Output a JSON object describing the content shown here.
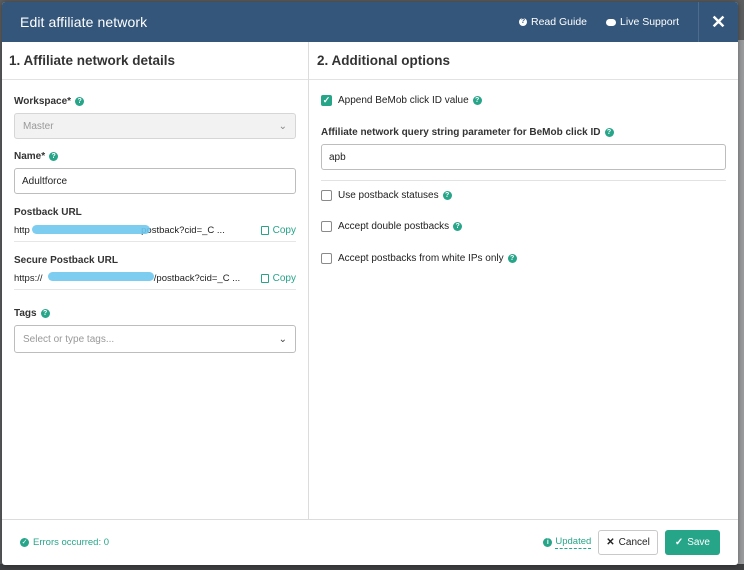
{
  "modal": {
    "title": "Edit affiliate network",
    "read_guide": "Read Guide",
    "live_support": "Live Support",
    "close": "✕"
  },
  "left": {
    "section_title": "1. Affiliate network details",
    "workspace_label": "Workspace*",
    "workspace_value": "Master",
    "name_label": "Name*",
    "name_value": "Adultforce",
    "postback_label": "Postback URL",
    "postback_prefix": "http",
    "postback_suffix": "postback?cid=_C ...",
    "secure_label": "Secure Postback URL",
    "secure_prefix": "https://",
    "secure_suffix": "/postback?cid=_C ...",
    "copy_label": "Copy",
    "tags_label": "Tags",
    "tags_placeholder": "Select or type tags..."
  },
  "right": {
    "section_title": "2. Additional options",
    "append_label": "Append BeMob click ID value",
    "append_checked": true,
    "param_label": "Affiliate network query string parameter for BeMob click ID",
    "param_value": "apb",
    "use_postback_label": "Use postback statuses",
    "accept_double_label": "Accept double postbacks",
    "white_ips_label": "Accept postbacks from white IPs only"
  },
  "footer": {
    "errors": "Errors occurred: 0",
    "updated": "Updated",
    "cancel": "Cancel",
    "save": "Save"
  },
  "colors": {
    "header": "#34567b",
    "accent": "#27a589"
  }
}
